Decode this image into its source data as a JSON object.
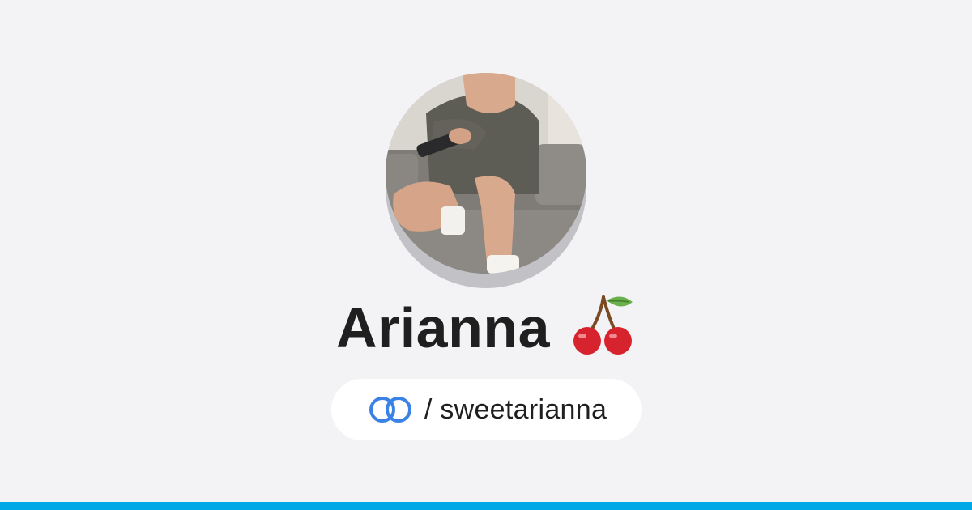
{
  "profile": {
    "name": "Arianna",
    "name_emoji": "cherries-icon",
    "handle_text": "/ sweetarianna",
    "link_icon": "chain-link-icon"
  },
  "colors": {
    "background": "#f3f3f6",
    "accent": "#00a9e6",
    "link_icon": "#3b82e6",
    "text": "#1f1f1f"
  }
}
